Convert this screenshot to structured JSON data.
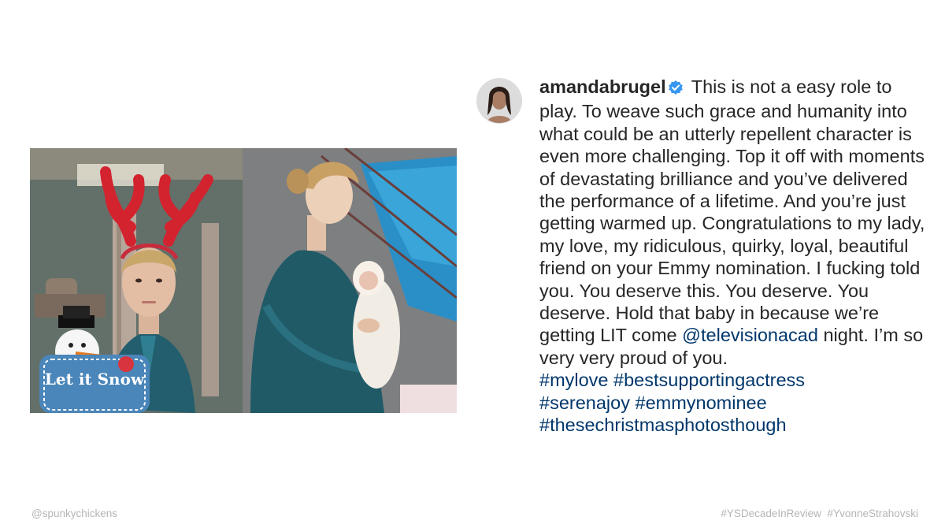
{
  "post": {
    "username": "amandabrugel",
    "caption_text": "This is not a easy role to play. To weave such grace and humanity into what could be an utterly repellent character is even more challenging. Top it off with moments of devastating brilliance and you’ve delivered the performance of a lifetime. And you’re just getting warmed up. Congratulations to my lady, my love, my ridiculous, quirky, loyal, beautiful friend on your Emmy nomination. I fucking told you. You deserve this. You deserve. You deserve. Hold that baby in because we’re getting LIT come ",
    "mention": "@televisionacad",
    "caption_tail": " night. I’m so very very proud of you.",
    "hashtags": [
      "#mylove",
      "#bestsupportingactress",
      "#serenajoy",
      "#emmynominee",
      "#thesechristmasphotosthough"
    ],
    "photo_sign_text": "Let it Snow"
  },
  "footer": {
    "credit": "@spunkychickens",
    "tags": "#YSDecadeInReview  #YvonneStrahovski"
  },
  "colors": {
    "link": "#00376b",
    "text": "#262626",
    "verified": "#3897f0",
    "footer": "#b5b5b5"
  }
}
